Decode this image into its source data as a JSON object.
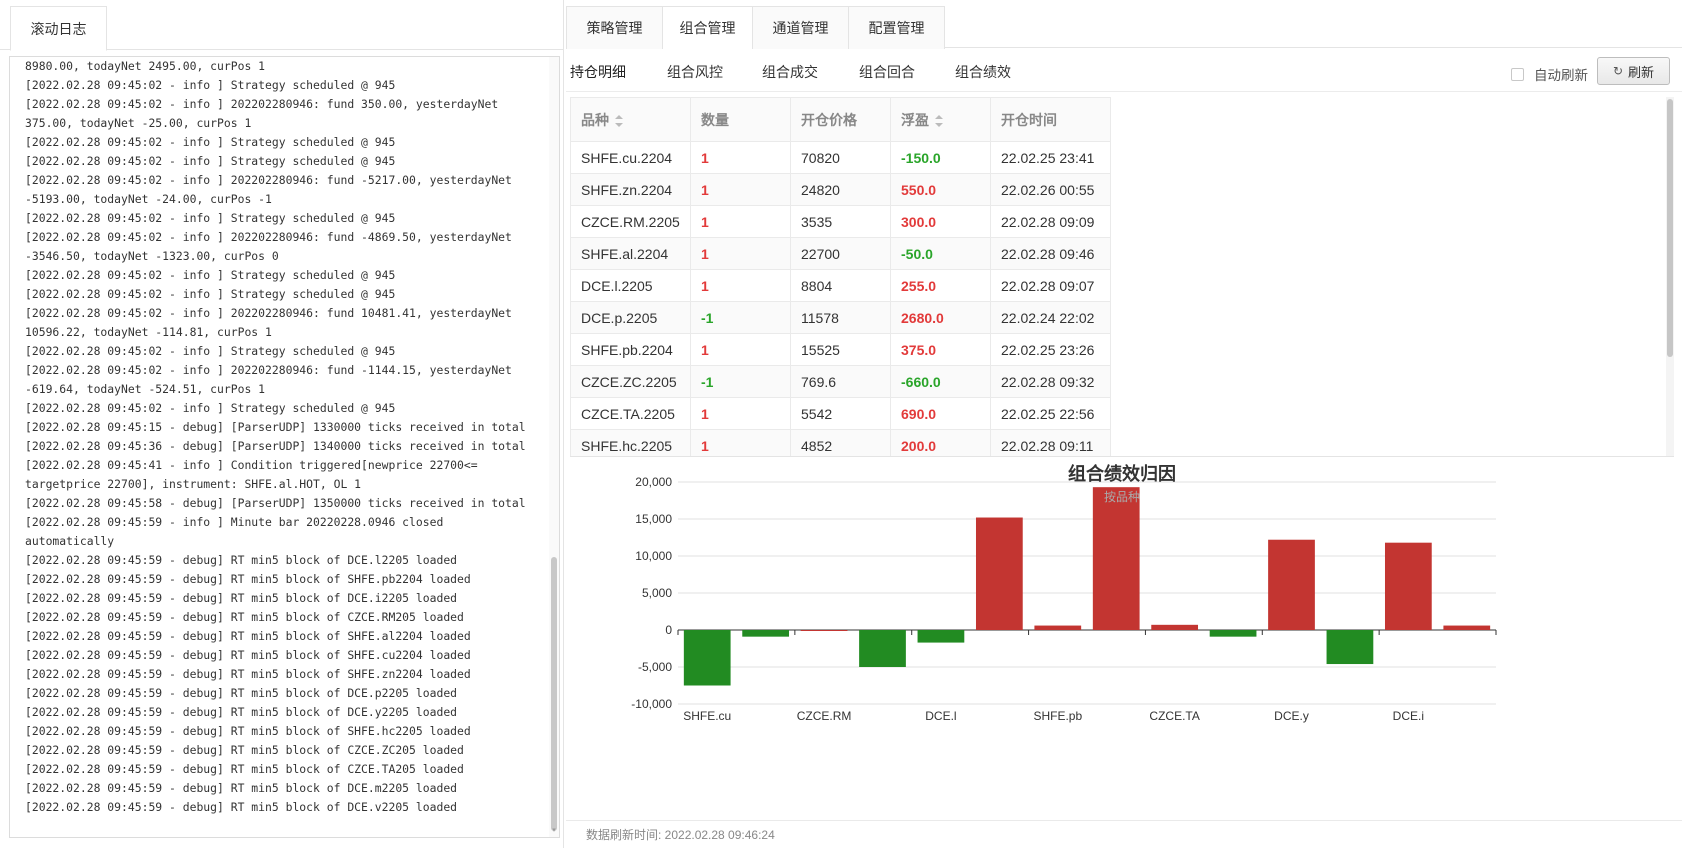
{
  "left_panel": {
    "tab_label": "滚动日志",
    "log_lines": [
      "8980.00, todayNet 2495.00, curPos 1",
      "[2022.02.28 09:45:02 - info ] Strategy scheduled @ 945",
      "[2022.02.28 09:45:02 - info ] 202202280946: fund 350.00, yesterdayNet",
      "375.00, todayNet -25.00, curPos 1",
      "[2022.02.28 09:45:02 - info ] Strategy scheduled @ 945",
      "[2022.02.28 09:45:02 - info ] Strategy scheduled @ 945",
      "[2022.02.28 09:45:02 - info ] 202202280946: fund -5217.00, yesterdayNet",
      "-5193.00, todayNet -24.00, curPos -1",
      "[2022.02.28 09:45:02 - info ] Strategy scheduled @ 945",
      "[2022.02.28 09:45:02 - info ] 202202280946: fund -4869.50, yesterdayNet",
      "-3546.50, todayNet -1323.00, curPos 0",
      "[2022.02.28 09:45:02 - info ] Strategy scheduled @ 945",
      "[2022.02.28 09:45:02 - info ] Strategy scheduled @ 945",
      "[2022.02.28 09:45:02 - info ] 202202280946: fund 10481.41, yesterdayNet",
      "10596.22, todayNet -114.81, curPos 1",
      "[2022.02.28 09:45:02 - info ] Strategy scheduled @ 945",
      "[2022.02.28 09:45:02 - info ] 202202280946: fund -1144.15, yesterdayNet",
      "-619.64, todayNet -524.51, curPos 1",
      "[2022.02.28 09:45:02 - info ] Strategy scheduled @ 945",
      "[2022.02.28 09:45:15 - debug] [ParserUDP] 1330000 ticks received in total",
      "[2022.02.28 09:45:36 - debug] [ParserUDP] 1340000 ticks received in total",
      "[2022.02.28 09:45:41 - info ] Condition triggered[newprice 22700<=",
      "targetprice 22700], instrument: SHFE.al.HOT, OL 1",
      "[2022.02.28 09:45:58 - debug] [ParserUDP] 1350000 ticks received in total",
      "[2022.02.28 09:45:59 - info ] Minute bar 20220228.0946 closed",
      "automatically",
      "[2022.02.28 09:45:59 - debug] RT min5 block of DCE.l2205 loaded",
      "[2022.02.28 09:45:59 - debug] RT min5 block of SHFE.pb2204 loaded",
      "[2022.02.28 09:45:59 - debug] RT min5 block of DCE.i2205 loaded",
      "[2022.02.28 09:45:59 - debug] RT min5 block of CZCE.RM205 loaded",
      "[2022.02.28 09:45:59 - debug] RT min5 block of SHFE.al2204 loaded",
      "[2022.02.28 09:45:59 - debug] RT min5 block of SHFE.cu2204 loaded",
      "[2022.02.28 09:45:59 - debug] RT min5 block of SHFE.zn2204 loaded",
      "[2022.02.28 09:45:59 - debug] RT min5 block of DCE.p2205 loaded",
      "[2022.02.28 09:45:59 - debug] RT min5 block of DCE.y2205 loaded",
      "[2022.02.28 09:45:59 - debug] RT min5 block of SHFE.hc2205 loaded",
      "[2022.02.28 09:45:59 - debug] RT min5 block of CZCE.ZC205 loaded",
      "[2022.02.28 09:45:59 - debug] RT min5 block of CZCE.TA205 loaded",
      "[2022.02.28 09:45:59 - debug] RT min5 block of DCE.m2205 loaded",
      "[2022.02.28 09:45:59 - debug] RT min5 block of DCE.v2205 loaded"
    ]
  },
  "top_tabs": [
    {
      "label": "策略管理"
    },
    {
      "label": "组合管理"
    },
    {
      "label": "通道管理"
    },
    {
      "label": "配置管理"
    }
  ],
  "sub_tabs": [
    {
      "label": "持仓明细"
    },
    {
      "label": "组合风控"
    },
    {
      "label": "组合成交"
    },
    {
      "label": "组合回合"
    },
    {
      "label": "组合绩效"
    }
  ],
  "toolbar": {
    "auto_refresh_label": "自动刷新",
    "refresh_label": "刷新",
    "refresh_icon": "refresh-icon"
  },
  "table": {
    "headers": [
      "品种",
      "数量",
      "开仓价格",
      "浮盈",
      "开仓时间"
    ],
    "rows": [
      {
        "symbol": "SHFE.cu.2204",
        "qty": "1",
        "price": "70820",
        "pnl": "-150.0",
        "time": "22.02.25 23:41"
      },
      {
        "symbol": "SHFE.zn.2204",
        "qty": "1",
        "price": "24820",
        "pnl": "550.0",
        "time": "22.02.26 00:55"
      },
      {
        "symbol": "CZCE.RM.2205",
        "qty": "1",
        "price": "3535",
        "pnl": "300.0",
        "time": "22.02.28 09:09"
      },
      {
        "symbol": "SHFE.al.2204",
        "qty": "1",
        "price": "22700",
        "pnl": "-50.0",
        "time": "22.02.28 09:46"
      },
      {
        "symbol": "DCE.l.2205",
        "qty": "1",
        "price": "8804",
        "pnl": "255.0",
        "time": "22.02.28 09:07"
      },
      {
        "symbol": "DCE.p.2205",
        "qty": "-1",
        "price": "11578",
        "pnl": "2680.0",
        "time": "22.02.24 22:02"
      },
      {
        "symbol": "SHFE.pb.2204",
        "qty": "1",
        "price": "15525",
        "pnl": "375.0",
        "time": "22.02.25 23:26"
      },
      {
        "symbol": "CZCE.ZC.2205",
        "qty": "-1",
        "price": "769.6",
        "pnl": "-660.0",
        "time": "22.02.28 09:32"
      },
      {
        "symbol": "CZCE.TA.2205",
        "qty": "1",
        "price": "5542",
        "pnl": "690.0",
        "time": "22.02.25 22:56"
      },
      {
        "symbol": "SHFE.hc.2205",
        "qty": "1",
        "price": "4852",
        "pnl": "200.0",
        "time": "22.02.28 09:11"
      }
    ]
  },
  "chart_data": {
    "type": "bar",
    "title": "组合绩效归因",
    "subtitle": "按品种",
    "xlabel": "",
    "ylabel": "",
    "ylim": [
      -10000,
      20000
    ],
    "yticks": [
      "20,000",
      "15,000",
      "10,000",
      "5,000",
      "0",
      "-5,000",
      "-10,000"
    ],
    "ytick_values": [
      20000,
      15000,
      10000,
      5000,
      0,
      -5000,
      -10000
    ],
    "xtick_labels": [
      "SHFE.cu",
      "CZCE.RM",
      "DCE.l",
      "SHFE.pb",
      "CZCE.TA",
      "DCE.y",
      "DCE.i"
    ],
    "categories": [
      "SHFE.cu",
      "",
      "CZCE.RM",
      "",
      "DCE.l",
      "",
      "SHFE.pb",
      "",
      "CZCE.TA",
      "",
      "DCE.y",
      "",
      "DCE.i",
      ""
    ],
    "values": [
      -7500,
      -900,
      0,
      -5000,
      -1700,
      15200,
      600,
      19300,
      700,
      -900,
      12200,
      -4600,
      11800,
      600
    ],
    "positive_color": "#c33531",
    "negative_color": "#228b22",
    "grid": true
  },
  "footer": {
    "label": "数据刷新时间: 2022.02.28 09:46:24"
  }
}
